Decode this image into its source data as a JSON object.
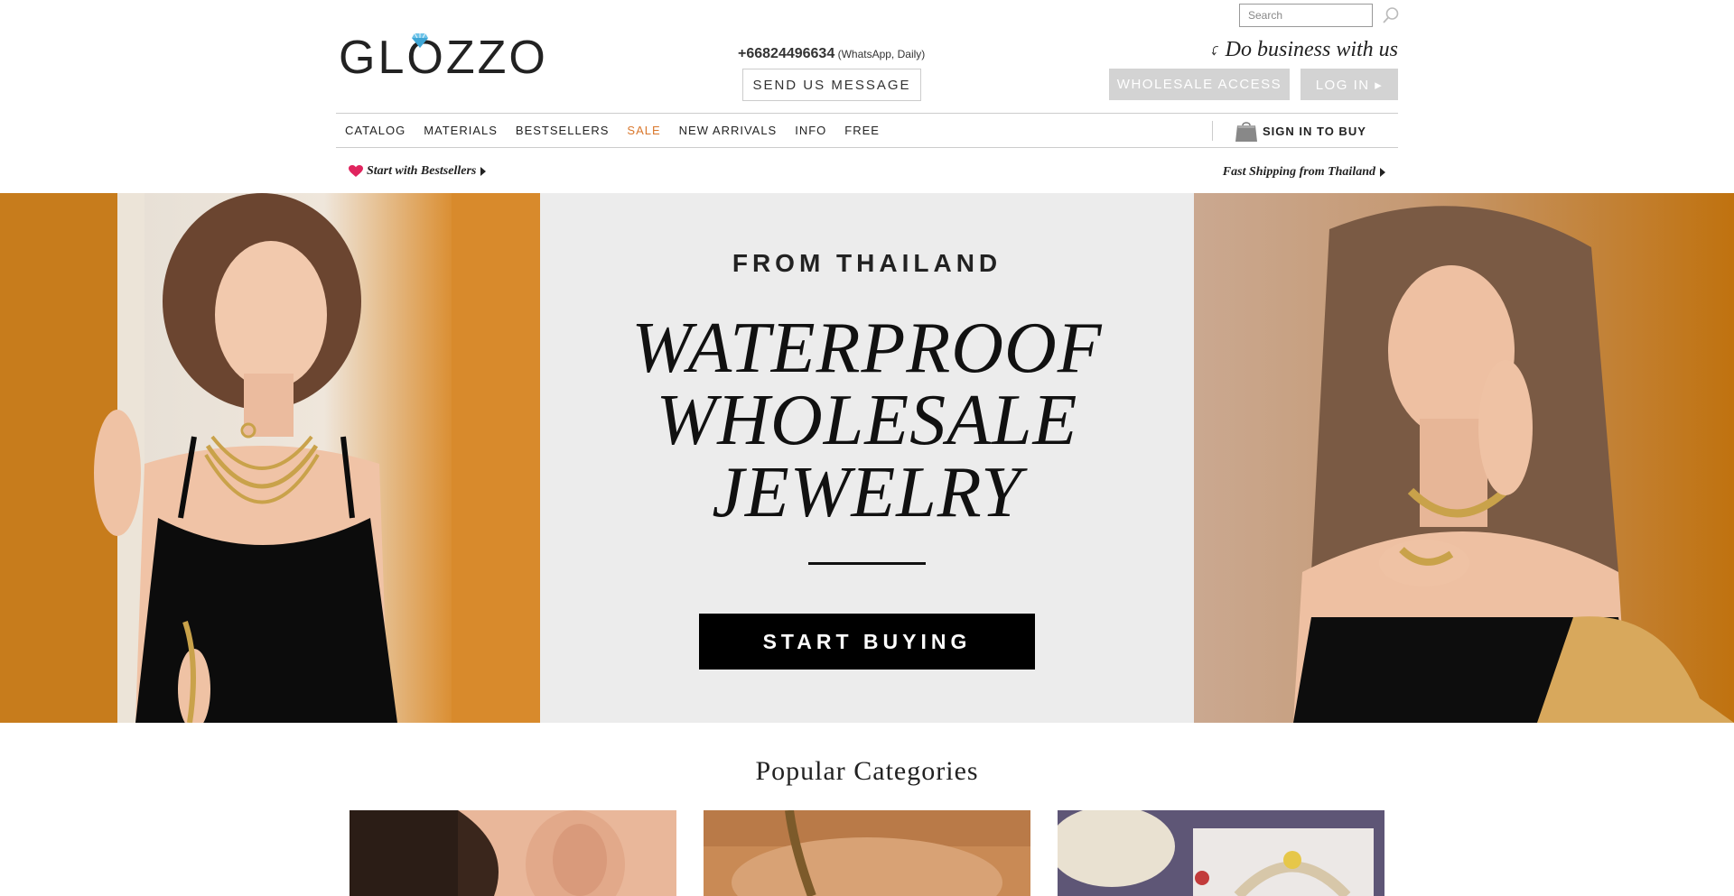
{
  "header": {
    "search_placeholder": "Search",
    "logo_text": "GLOZZO",
    "phone": "+66824496634",
    "phone_note": "(WhatsApp, Daily)",
    "send_message_label": "SEND US MESSAGE",
    "business_text": "Do business with us",
    "wholesale_label": "WHOLESALE ACCESS",
    "login_label": "LOG IN ▸"
  },
  "nav": {
    "items": [
      {
        "label": "CATALOG"
      },
      {
        "label": "MATERIALS"
      },
      {
        "label": "BESTSELLERS"
      },
      {
        "label": "SALE"
      },
      {
        "label": "NEW ARRIVALS"
      },
      {
        "label": "INFO"
      },
      {
        "label": "FREE"
      }
    ],
    "sign_in_label": "SIGN IN TO BUY"
  },
  "sublinks": {
    "left": "Start with Bestsellers",
    "right": "Fast Shipping from Thailand"
  },
  "hero": {
    "eyebrow": "FROM THAILAND",
    "title_line1": "WATERPROOF",
    "title_line2": "WHOLESALE",
    "title_line3": "JEWELRY",
    "cta": "START BUYING"
  },
  "popular": {
    "title": "Popular Categories"
  },
  "colors": {
    "accent_sale": "#d9772c",
    "button_gray": "#d3d3d3",
    "heart": "#e0245e",
    "hero_bg": "#ececec"
  }
}
